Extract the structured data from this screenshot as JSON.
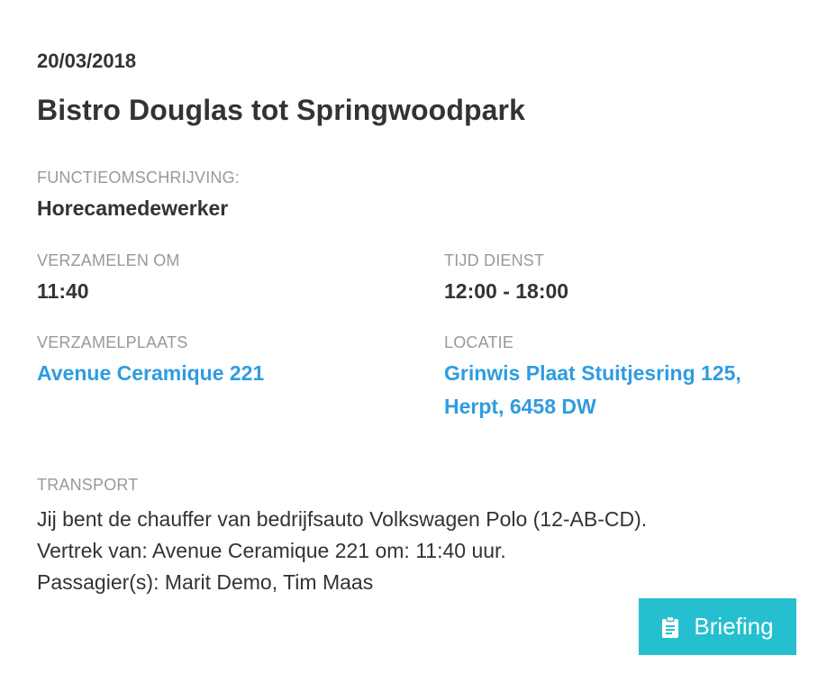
{
  "date": "20/03/2018",
  "title": "Bistro Douglas tot Springwoodpark",
  "function": {
    "label": "FUNCTIEOMSCHRIJVING:",
    "value": "Horecamedewerker"
  },
  "gather_time": {
    "label": "VERZAMELEN OM",
    "value": "11:40"
  },
  "shift_time": {
    "label": "TIJD DIENST",
    "value": "12:00 - 18:00"
  },
  "gather_place": {
    "label": "VERZAMELPLAATS",
    "value": "Avenue Ceramique 221"
  },
  "location": {
    "label": "LOCATIE",
    "line1": "Grinwis Plaat Stuitjesring 125,",
    "line2": "Herpt, 6458 DW"
  },
  "transport": {
    "label": "TRANSPORT",
    "lines": [
      "Jij bent de chauffer van bedrijfsauto Volkswagen Polo (12-AB-CD).",
      "Vertrek van: Avenue Ceramique 221 om: 11:40 uur.",
      "Passagier(s): Marit Demo, Tim Maas"
    ]
  },
  "briefing_button": {
    "label": "Briefing",
    "icon": "clipboard-icon",
    "color": "#26bfd0"
  },
  "colors": {
    "link": "#2f9ce0",
    "label": "#999999",
    "text": "#333333"
  }
}
